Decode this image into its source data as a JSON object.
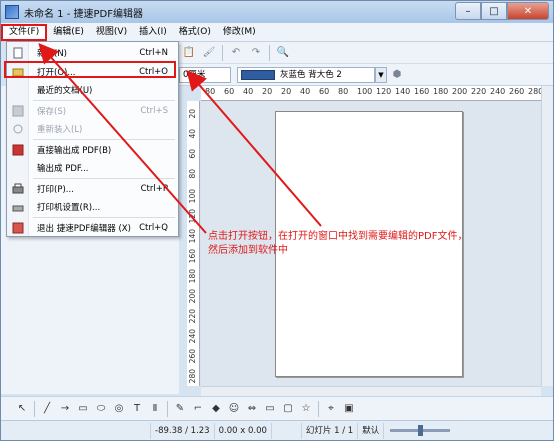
{
  "window": {
    "title": "未命名 1 - 捷速PDF编辑器"
  },
  "menubar": {
    "items": [
      {
        "label": "文件(F)"
      },
      {
        "label": "编辑(E)"
      },
      {
        "label": "视图(V)"
      },
      {
        "label": "插入(I)"
      },
      {
        "label": "格式(O)"
      },
      {
        "label": "修改(M)"
      }
    ]
  },
  "file_menu": {
    "items": [
      {
        "label": "新建(N)",
        "shortcut": "Ctrl+N",
        "disabled": false,
        "icon": "new-document-icon"
      },
      {
        "label": "打开(O)...",
        "shortcut": "Ctrl+O",
        "disabled": false,
        "icon": "open-folder-icon"
      },
      {
        "label": "最近的文档(U)",
        "shortcut": "",
        "disabled": false,
        "icon": ""
      },
      {
        "label": "保存(S)",
        "shortcut": "Ctrl+S",
        "disabled": true,
        "icon": "save-icon"
      },
      {
        "label": "重新装入(L)",
        "shortcut": "",
        "disabled": true,
        "icon": "reload-icon"
      },
      {
        "label": "直接输出成 PDF(B)",
        "shortcut": "",
        "disabled": false,
        "icon": "export-pdf-icon"
      },
      {
        "label": "输出成 PDF...",
        "shortcut": "",
        "disabled": false,
        "icon": ""
      },
      {
        "label": "打印(P)...",
        "shortcut": "Ctrl+P",
        "disabled": false,
        "icon": "print-icon"
      },
      {
        "label": "打印机设置(R)...",
        "shortcut": "",
        "disabled": false,
        "icon": "printer-settings-icon"
      },
      {
        "label": "退出 捷速PDF编辑器 (X)",
        "shortcut": "Ctrl+Q",
        "disabled": false,
        "icon": "exit-icon"
      }
    ]
  },
  "format_bar": {
    "line_width": "0厘米",
    "fill_color": "灰蓝色 背大色 2"
  },
  "ruler": {
    "h_ticks": [
      "80",
      "60",
      "40",
      "20",
      "20",
      "40",
      "60",
      "80",
      "100",
      "120",
      "140",
      "160",
      "180",
      "200",
      "220",
      "240",
      "260",
      "280"
    ],
    "v_ticks": [
      "20",
      "40",
      "60",
      "80",
      "100",
      "120",
      "140",
      "160",
      "180",
      "200",
      "220",
      "240",
      "260",
      "280"
    ]
  },
  "annotation": {
    "line1": "点击打开按钮，在打开的窗口中找到需要编辑的PDF文件，",
    "line2": "然后添加到软件中"
  },
  "statusbar": {
    "position": "-89.38 / 1.23",
    "size": "0.00 x 0.00",
    "slide": "幻灯片 1 / 1",
    "layout": "默认"
  },
  "colors": {
    "accent_red": "#e01818",
    "fill_swatch": "#2f5da0"
  }
}
